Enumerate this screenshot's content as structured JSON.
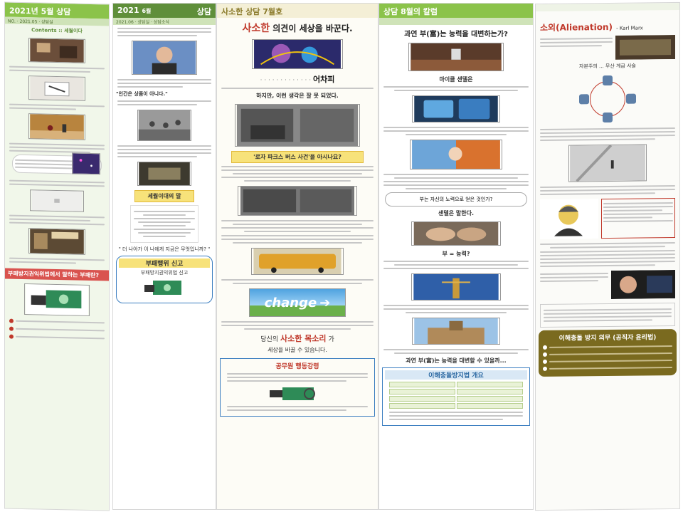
{
  "col1": {
    "masthead": "2021년 5월 상담",
    "subbar": "NO.  ·  2021.05  ·  상담실",
    "contents_label": "Contents :: 세월이다",
    "quote_heading": "",
    "redbar": "부패방지권익위법에서 말하는 부패란?"
  },
  "col2": {
    "masthead_year": "2021",
    "masthead_month": "6월",
    "masthead_name": "상담",
    "subbar": "2021.06  ·  상담실  ·  상담소식",
    "portrait_caption": "",
    "quote_line": "\"인간은 상품이 아니다.\"",
    "note_title": "세월이대의 말",
    "bottom_note": "\" 더 나아가 이 나에게 지금은 무엇입니까? \"",
    "box_title": "부패행위 신고",
    "box_sub": "부패방지권익위법 신고"
  },
  "col3": {
    "masthead": "사소한 상담  7월호",
    "headline_red": "사소한",
    "headline_rest": "의견이 세상을 바꾼다.",
    "highlight_word": "어차피",
    "sub_heading": "하지만, 이런 생각은 잘 못 되었다.",
    "banner": "'로자 파크스 버스 사건'을 아시나요?",
    "change_word": "change",
    "closing_pre": "당신의",
    "closing_red": "사소한 목소리",
    "closing_post": "가",
    "closing_line2": "세상을 바꿀 수 있습니다.",
    "bottom_box_title": "공무원 행동강령"
  },
  "col4": {
    "masthead": "상담  8월의 칼럼",
    "headline": "과연 부(富)는 능력을 대변하는가?",
    "sub1": "마이클 샌델은",
    "oval_text": "부는 자신의 노력으로 얻은 것인가?",
    "question": "샌델은 말한다.",
    "sub_question": "부 = 능력?",
    "closing": "과연 부(富)는 능력을 대변할 수 있을까...",
    "bottom_box_title": "이해충돌방지법 개요"
  },
  "col5": {
    "heading": "소외(Alienation)",
    "heading_author": "- Karl Marx",
    "diagram_label": "자본주의 ... 무산 계급 사슬",
    "marx_caption": "",
    "quote_sig": "",
    "bottom_box_title": "이해충돌 방지 의무 (공직자 윤리법)"
  },
  "colors": {
    "green": "#8bc34a",
    "red": "#c0392b",
    "blue": "#3a7dc0",
    "olive": "#7a6a1f",
    "yellow": "#f7e27a"
  }
}
